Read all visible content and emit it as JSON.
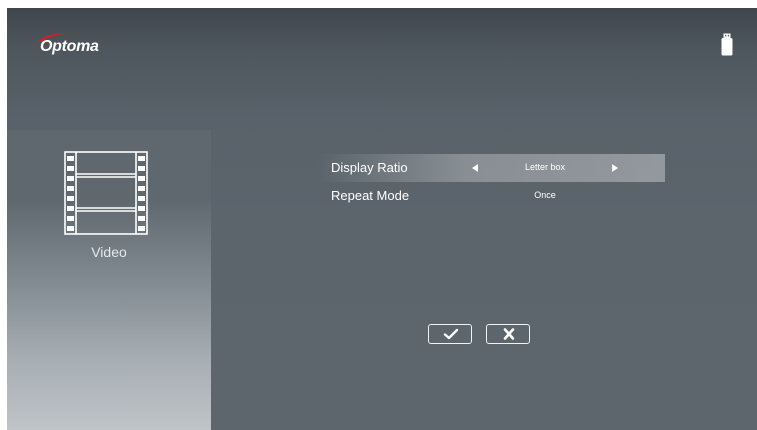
{
  "brand": {
    "logo_text": "Optoma",
    "swoosh_color": "#d01f26"
  },
  "status": {
    "storage_icon": "usb-drive-icon"
  },
  "media_panel": {
    "icon": "film-strip-icon",
    "label": "Video"
  },
  "settings": {
    "items": [
      {
        "label": "Display Ratio",
        "value": "Letter box",
        "selected": true,
        "has_arrows": true
      },
      {
        "label": "Repeat Mode",
        "value": "Once",
        "selected": false,
        "has_arrows": false
      }
    ]
  },
  "dialog_buttons": {
    "confirm_icon": "checkmark-icon",
    "cancel_icon": "x-icon"
  },
  "colors": {
    "background": "#5b646b",
    "highlight": "#8b9297",
    "text": "#ffffff"
  }
}
